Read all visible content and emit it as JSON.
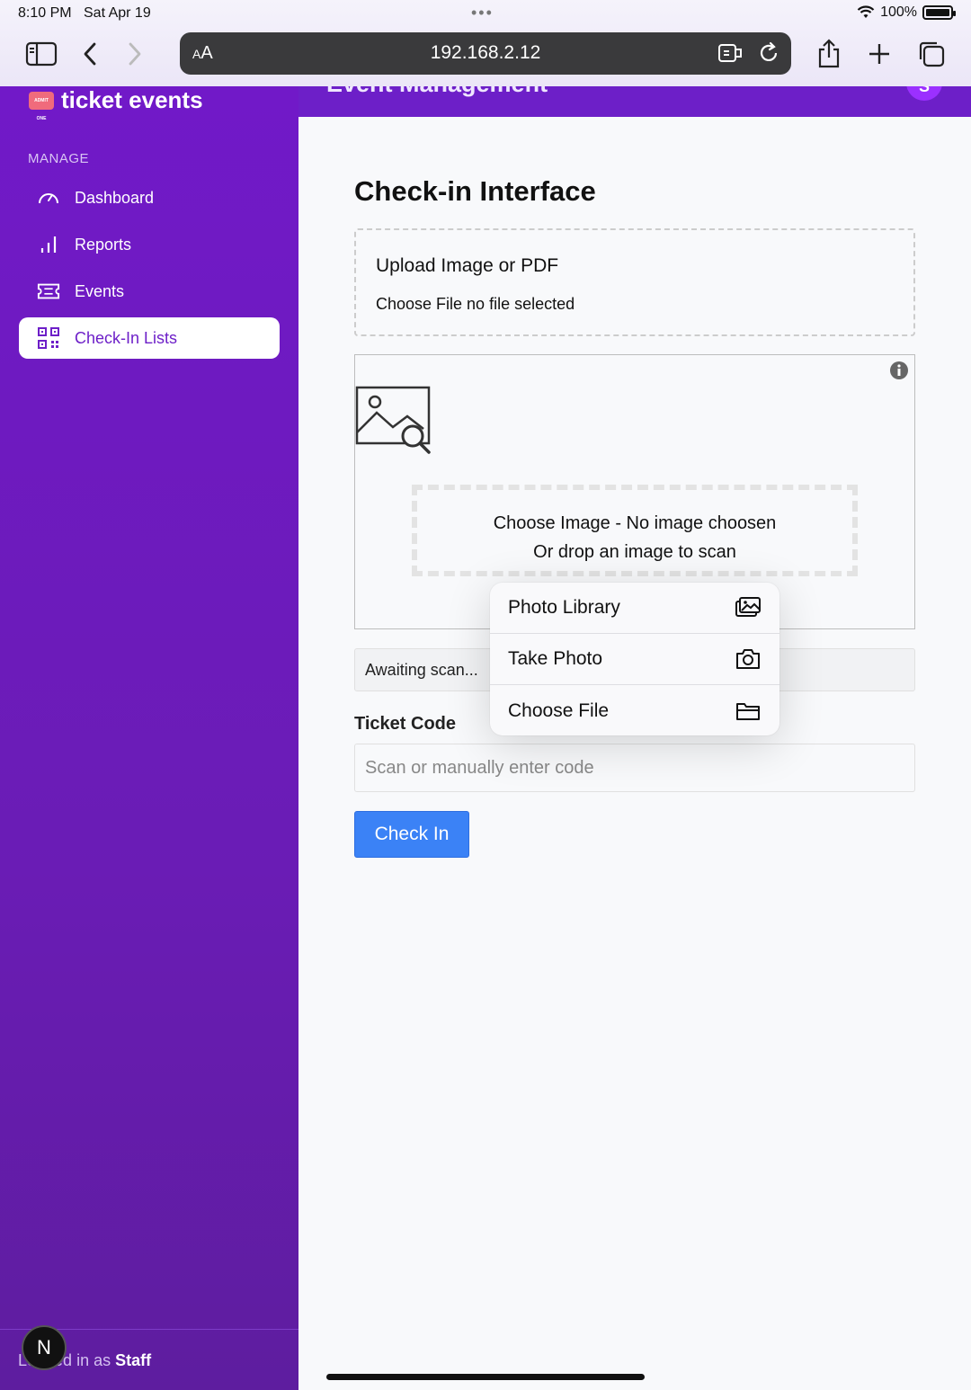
{
  "status_bar": {
    "time": "8:10 PM",
    "date": "Sat Apr 19",
    "battery": "100%"
  },
  "browser": {
    "url": "192.168.2.12",
    "text_size_label_small": "A",
    "text_size_label_large": "A"
  },
  "app_header": {
    "title": "Event Management",
    "avatar_initial": "S"
  },
  "sidebar": {
    "brand": "ticket events",
    "brand_logo_text": "ADMIT ONE",
    "section_label": "MANAGE",
    "items": [
      {
        "label": "Dashboard",
        "icon": "gauge-icon"
      },
      {
        "label": "Reports",
        "icon": "bar-chart-icon"
      },
      {
        "label": "Events",
        "icon": "ticket-icon"
      },
      {
        "label": "Check-In Lists",
        "icon": "qr-code-icon",
        "active": true
      }
    ],
    "footer_prefix": "Logged in as",
    "footer_role": "Staff",
    "dev_badge": "N"
  },
  "main": {
    "title": "Check-in Interface",
    "upload": {
      "title": "Upload Image or PDF",
      "status": "Choose File no file selected"
    },
    "scanner": {
      "line1": "Choose Image - No image choosen",
      "line2": "Or drop an image to scan"
    },
    "scan_status": "Awaiting scan...",
    "ticket_code_label": "Ticket Code",
    "ticket_code_placeholder": "Scan or manually enter code",
    "checkin_button": "Check In"
  },
  "popover": {
    "items": [
      {
        "label": "Photo Library",
        "icon": "photo-library-icon"
      },
      {
        "label": "Take Photo",
        "icon": "camera-icon"
      },
      {
        "label": "Choose File",
        "icon": "folder-icon"
      }
    ]
  },
  "colors": {
    "sidebar_purple": "#6d1fc8",
    "button_blue": "#3b82f6",
    "active_text": "#6d1fc8"
  }
}
